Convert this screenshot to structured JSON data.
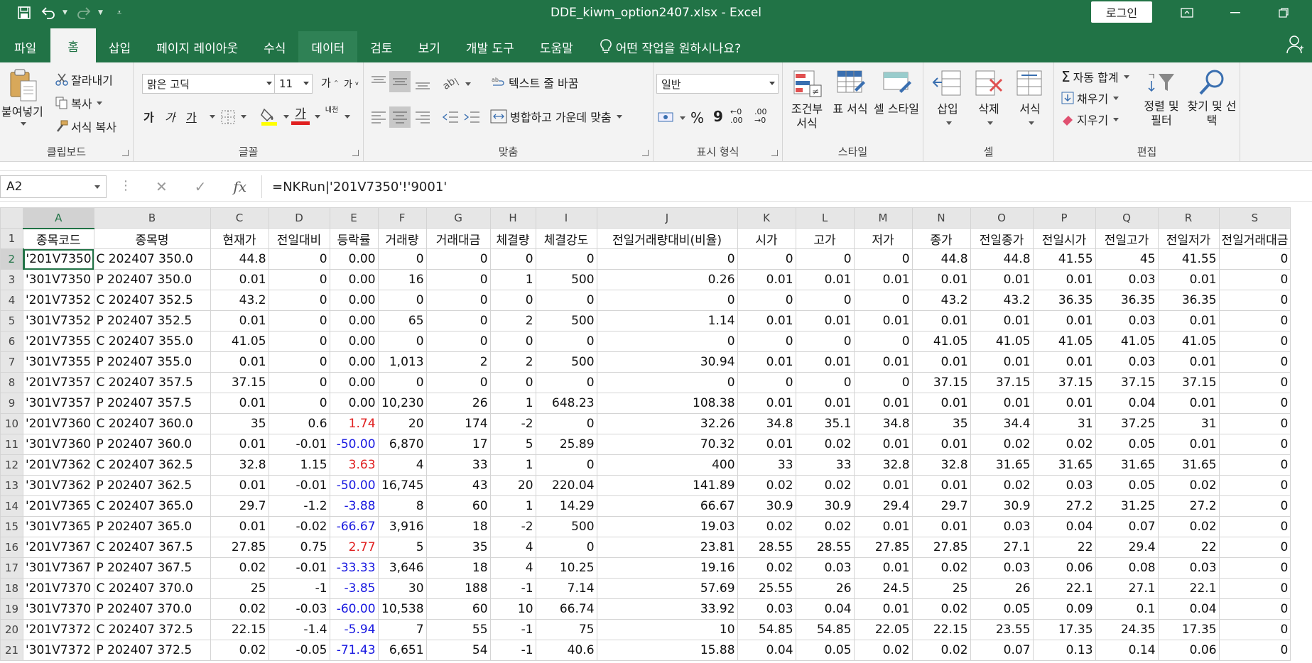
{
  "window": {
    "title": "DDE_kiwm_option2407.xlsx  -  Excel",
    "login_label": "로그인"
  },
  "tabs": [
    "파일",
    "홈",
    "삽입",
    "페이지 레이아웃",
    "수식",
    "데이터",
    "검토",
    "보기",
    "개발 도구",
    "도움말"
  ],
  "tell_me": "어떤 작업을 원하시나요?",
  "ribbon": {
    "clipboard": {
      "paste": "붙여넣기",
      "cut": "잘라내기",
      "copy": "복사",
      "format_painter": "서식 복사",
      "label": "클립보드"
    },
    "font": {
      "font_name": "맑은 고딕",
      "font_size": "11",
      "grow": "가",
      "shrink": "가",
      "bold": "가",
      "italic": "가",
      "underline": "가",
      "color_letter": "가",
      "phonetic": "내천",
      "label": "글꼴"
    },
    "alignment": {
      "wrap": "텍스트 줄 바꿈",
      "merge": "병합하고 가운데 맞춤",
      "label": "맞춤"
    },
    "number": {
      "format": "일반",
      "percent": "%",
      "comma": "9",
      "inc": "←0 .00",
      "dec": ".00 →0",
      "label": "표시 형식"
    },
    "styles": {
      "conditional": "조건부 서식",
      "table": "표 서식",
      "cell_style": "셀 스타일",
      "label": "스타일"
    },
    "cells": {
      "insert": "삽입",
      "delete": "삭제",
      "format": "서식",
      "label": "셀"
    },
    "editing": {
      "autosum": "자동 합계",
      "fill": "채우기",
      "clear": "지우기",
      "sort": "정렬 및 필터",
      "find": "찾기 및 선택",
      "label": "편집"
    }
  },
  "formula_bar": {
    "name_box": "A2",
    "formula": "=NKRun|'201V7350'!'9001'"
  },
  "sheet": {
    "col_letters": [
      "A",
      "B",
      "C",
      "D",
      "E",
      "F",
      "G",
      "H",
      "I",
      "J",
      "K",
      "L",
      "M",
      "N",
      "O",
      "P",
      "Q",
      "R",
      "S"
    ],
    "headers": [
      "종목코드",
      "종목명",
      "현재가",
      "전일대비",
      "등락률",
      "거래량",
      "거래대금",
      "체결량",
      "체결강도",
      "전일거래량대비(비율)",
      "시가",
      "고가",
      "저가",
      "종가",
      "전일종가",
      "전일시가",
      "전일고가",
      "전일저가",
      "전일거래대금"
    ],
    "rows": [
      [
        "'201V7350",
        "C 202407 350.0",
        "44.8",
        "0",
        "0.00",
        "0",
        "0",
        "0",
        "0",
        "0",
        "0",
        "0",
        "0",
        "44.8",
        "44.8",
        "41.55",
        "45",
        "41.55",
        "0"
      ],
      [
        "'301V7350",
        "P 202407 350.0",
        "0.01",
        "0",
        "0.00",
        "16",
        "0",
        "1",
        "500",
        "0.26",
        "0.01",
        "0.01",
        "0.01",
        "0.01",
        "0.01",
        "0.01",
        "0.03",
        "0.01",
        "0"
      ],
      [
        "'201V7352",
        "C 202407 352.5",
        "43.2",
        "0",
        "0.00",
        "0",
        "0",
        "0",
        "0",
        "0",
        "0",
        "0",
        "0",
        "43.2",
        "43.2",
        "36.35",
        "36.35",
        "36.35",
        "0"
      ],
      [
        "'301V7352",
        "P 202407 352.5",
        "0.01",
        "0",
        "0.00",
        "65",
        "0",
        "2",
        "500",
        "1.14",
        "0.01",
        "0.01",
        "0.01",
        "0.01",
        "0.01",
        "0.01",
        "0.03",
        "0.01",
        "0"
      ],
      [
        "'201V7355",
        "C 202407 355.0",
        "41.05",
        "0",
        "0.00",
        "0",
        "0",
        "0",
        "0",
        "0",
        "0",
        "0",
        "0",
        "41.05",
        "41.05",
        "41.05",
        "41.05",
        "41.05",
        "0"
      ],
      [
        "'301V7355",
        "P 202407 355.0",
        "0.01",
        "0",
        "0.00",
        "1,013",
        "2",
        "2",
        "500",
        "30.94",
        "0.01",
        "0.01",
        "0.01",
        "0.01",
        "0.01",
        "0.01",
        "0.03",
        "0.01",
        "0"
      ],
      [
        "'201V7357",
        "C 202407 357.5",
        "37.15",
        "0",
        "0.00",
        "0",
        "0",
        "0",
        "0",
        "0",
        "0",
        "0",
        "0",
        "37.15",
        "37.15",
        "37.15",
        "37.15",
        "37.15",
        "0"
      ],
      [
        "'301V7357",
        "P 202407 357.5",
        "0.01",
        "0",
        "0.00",
        "10,230",
        "26",
        "1",
        "648.23",
        "108.38",
        "0.01",
        "0.01",
        "0.01",
        "0.01",
        "0.01",
        "0.01",
        "0.04",
        "0.01",
        "0"
      ],
      [
        "'201V7360",
        "C 202407 360.0",
        "35",
        "0.6",
        "1.74",
        "20",
        "174",
        "-2",
        "0",
        "32.26",
        "34.8",
        "35.1",
        "34.8",
        "35",
        "34.4",
        "31",
        "37.25",
        "31",
        "0"
      ],
      [
        "'301V7360",
        "P 202407 360.0",
        "0.01",
        "-0.01",
        "-50.00",
        "6,870",
        "17",
        "5",
        "25.89",
        "70.32",
        "0.01",
        "0.02",
        "0.01",
        "0.01",
        "0.02",
        "0.02",
        "0.05",
        "0.01",
        "0"
      ],
      [
        "'201V7362",
        "C 202407 362.5",
        "32.8",
        "1.15",
        "3.63",
        "4",
        "33",
        "1",
        "0",
        "400",
        "33",
        "33",
        "32.8",
        "32.8",
        "31.65",
        "31.65",
        "31.65",
        "31.65",
        "0"
      ],
      [
        "'301V7362",
        "P 202407 362.5",
        "0.01",
        "-0.01",
        "-50.00",
        "16,745",
        "43",
        "20",
        "220.04",
        "141.89",
        "0.02",
        "0.02",
        "0.01",
        "0.01",
        "0.02",
        "0.03",
        "0.05",
        "0.02",
        "0"
      ],
      [
        "'201V7365",
        "C 202407 365.0",
        "29.7",
        "-1.2",
        "-3.88",
        "8",
        "60",
        "1",
        "14.29",
        "66.67",
        "30.9",
        "30.9",
        "29.4",
        "29.7",
        "30.9",
        "27.2",
        "31.25",
        "27.2",
        "0"
      ],
      [
        "'301V7365",
        "P 202407 365.0",
        "0.01",
        "-0.02",
        "-66.67",
        "3,916",
        "18",
        "-2",
        "500",
        "19.03",
        "0.02",
        "0.02",
        "0.01",
        "0.01",
        "0.03",
        "0.04",
        "0.07",
        "0.02",
        "0"
      ],
      [
        "'201V7367",
        "C 202407 367.5",
        "27.85",
        "0.75",
        "2.77",
        "5",
        "35",
        "4",
        "0",
        "23.81",
        "28.55",
        "28.55",
        "27.85",
        "27.85",
        "27.1",
        "22",
        "29.4",
        "22",
        "0"
      ],
      [
        "'301V7367",
        "P 202407 367.5",
        "0.02",
        "-0.01",
        "-33.33",
        "3,646",
        "18",
        "4",
        "10.25",
        "19.16",
        "0.02",
        "0.03",
        "0.01",
        "0.02",
        "0.03",
        "0.06",
        "0.08",
        "0.03",
        "0"
      ],
      [
        "'201V7370",
        "C 202407 370.0",
        "25",
        "-1",
        "-3.85",
        "30",
        "188",
        "-1",
        "7.14",
        "57.69",
        "25.55",
        "26",
        "24.5",
        "25",
        "26",
        "22.1",
        "27.1",
        "22.1",
        "0"
      ],
      [
        "'301V7370",
        "P 202407 370.0",
        "0.02",
        "-0.03",
        "-60.00",
        "10,538",
        "60",
        "10",
        "66.74",
        "33.92",
        "0.03",
        "0.04",
        "0.01",
        "0.02",
        "0.05",
        "0.09",
        "0.1",
        "0.04",
        "0"
      ],
      [
        "'201V7372",
        "C 202407 372.5",
        "22.15",
        "-1.4",
        "-5.94",
        "7",
        "55",
        "-1",
        "75",
        "10",
        "54.85",
        "54.85",
        "22.05",
        "22.15",
        "23.55",
        "17.35",
        "24.35",
        "17.35",
        "0"
      ],
      [
        "'301V7372",
        "P 202407 372.5",
        "0.02",
        "-0.05",
        "-71.43",
        "6,651",
        "54",
        "-1",
        "40.6",
        "15.88",
        "0.04",
        "0.05",
        "0.02",
        "0.02",
        "0.07",
        "0.13",
        "0.14",
        "0.06",
        "0"
      ]
    ],
    "colors": {
      "positive": "#e02020",
      "negative": "#1818e0",
      "accent": "#217346"
    }
  }
}
